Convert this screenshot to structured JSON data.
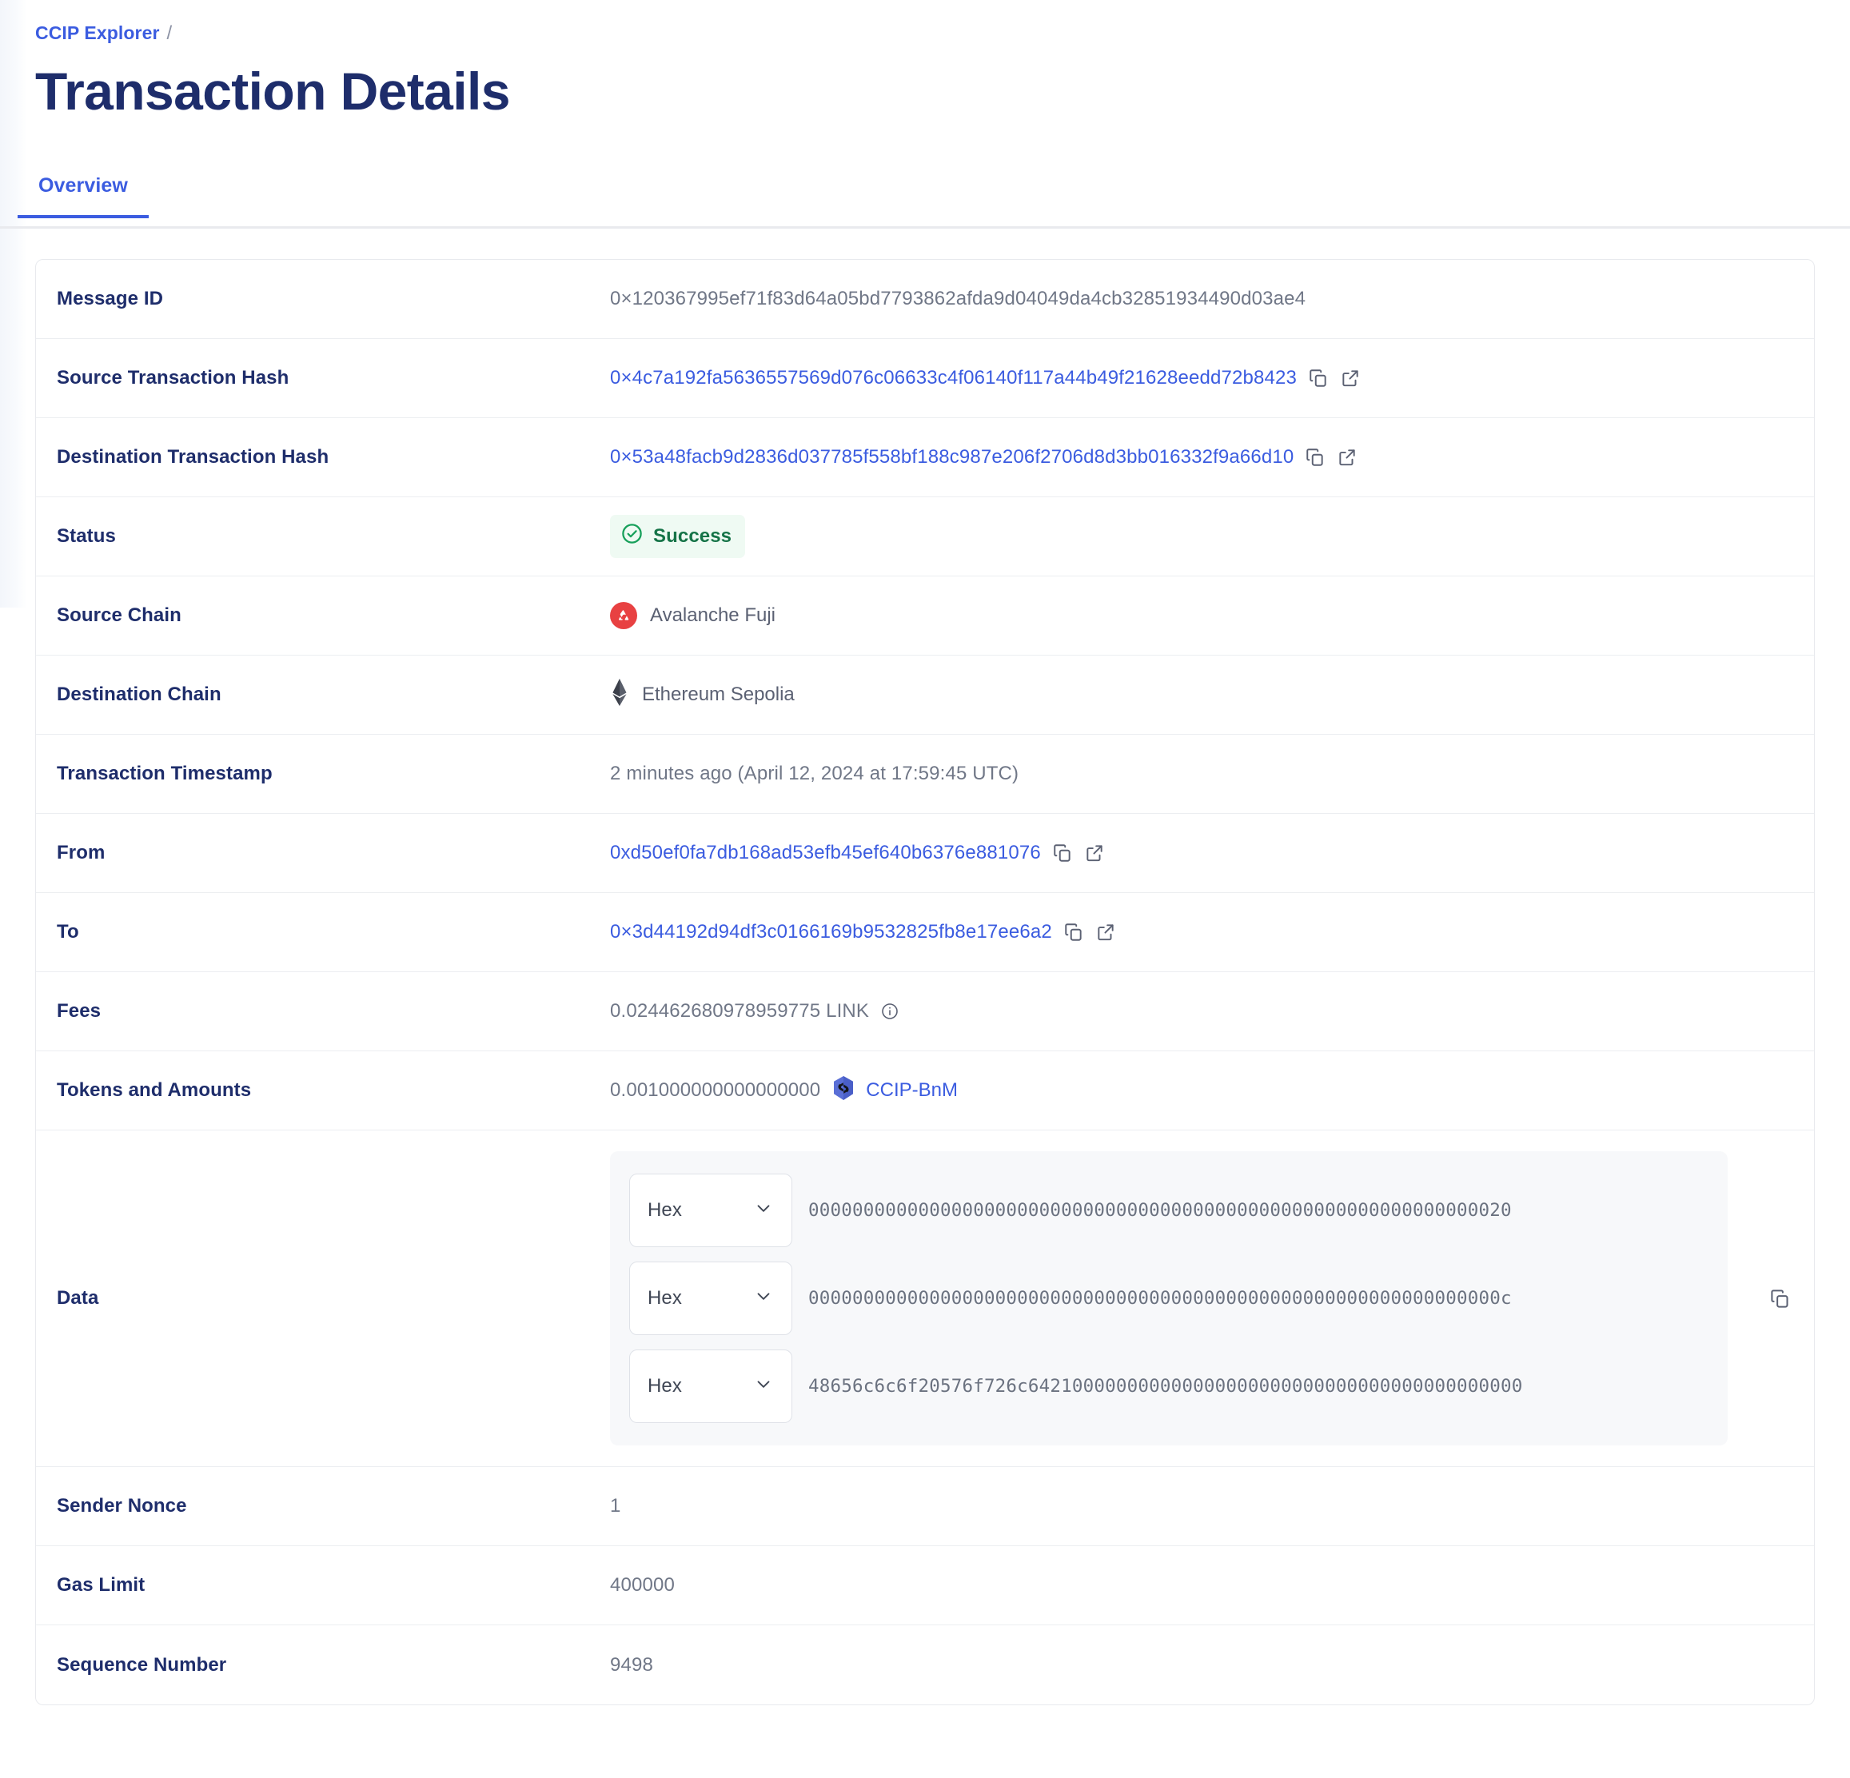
{
  "breadcrumb": {
    "parent": "CCIP Explorer",
    "separator": "/"
  },
  "page_title": "Transaction Details",
  "tabs": [
    {
      "label": "Overview",
      "active": true
    }
  ],
  "colors": {
    "accent": "#3b5ce0",
    "title": "#1e2d6b",
    "success_text": "#157347",
    "success_bg": "#effaf3",
    "avalanche_red": "#e84142",
    "value_gray": "#707787"
  },
  "details": {
    "message_id": {
      "label": "Message ID",
      "value": "0×120367995ef71f83d64a05bd7793862afda9d04049da4cb32851934490d03ae4"
    },
    "source_tx_hash": {
      "label": "Source Transaction Hash",
      "value": "0×4c7a192fa5636557569d076c06633c4f06140f117a44b49f21628eedd72b8423"
    },
    "destination_tx_hash": {
      "label": "Destination Transaction Hash",
      "value": "0×53a48facb9d2836d037785f558bf188c987e206f2706d8d3bb016332f9a66d10"
    },
    "status": {
      "label": "Status",
      "value": "Success"
    },
    "source_chain": {
      "label": "Source Chain",
      "value": "Avalanche Fuji"
    },
    "destination_chain": {
      "label": "Destination Chain",
      "value": "Ethereum Sepolia"
    },
    "timestamp": {
      "label": "Transaction Timestamp",
      "value": "2 minutes ago (April 12, 2024 at 17:59:45 UTC)"
    },
    "from": {
      "label": "From",
      "value": "0xd50ef0fa7db168ad53efb45ef640b6376e881076"
    },
    "to": {
      "label": "To",
      "value": "0×3d44192d94df3c0166169b9532825fb8e17ee6a2"
    },
    "fees": {
      "label": "Fees",
      "value": "0.024462680978959775 LINK"
    },
    "tokens_and_amounts": {
      "label": "Tokens and Amounts",
      "amount": "0.001000000000000000",
      "token_symbol": "CCIP-BnM"
    },
    "data": {
      "label": "Data",
      "lines": [
        {
          "format": "Hex",
          "value": "0000000000000000000000000000000000000000000000000000000000000020"
        },
        {
          "format": "Hex",
          "value": "000000000000000000000000000000000000000000000000000000000000000c"
        },
        {
          "format": "Hex",
          "value": "48656c6c6f20576f726c642100000000000000000000000000000000000000000"
        }
      ]
    },
    "sender_nonce": {
      "label": "Sender Nonce",
      "value": "1"
    },
    "gas_limit": {
      "label": "Gas Limit",
      "value": "400000"
    },
    "sequence_number": {
      "label": "Sequence Number",
      "value": "9498"
    }
  }
}
